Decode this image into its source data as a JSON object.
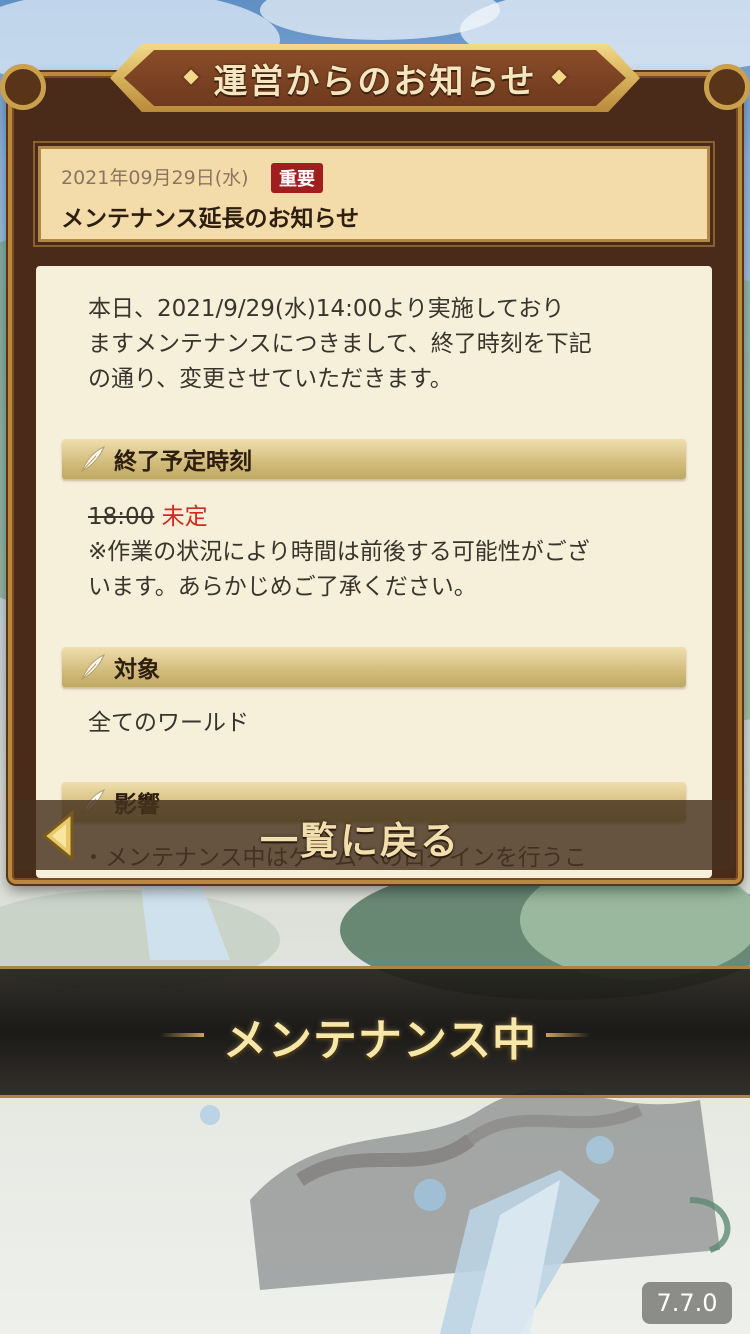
{
  "window_title": "運営からのお知らせ",
  "notice": {
    "date": "2021年09月29日(水)",
    "badge": "重要",
    "title": "メンテナンス延長のお知らせ",
    "intro_lines": [
      "本日、2021/9/29(水)14:00より実施しており",
      "ますメンテナンスにつきまして、終了時刻を下記",
      "の通り、変更させていただきます。"
    ],
    "sections": [
      {
        "heading": "終了予定時刻",
        "old_time": "18:00",
        "new_time": "未定",
        "note_lines": [
          "※作業の状況により時間は前後する可能性がござ",
          "います。あらかじめご了承ください。"
        ]
      },
      {
        "heading": "対象",
        "body": "全てのワールド"
      },
      {
        "heading": "影響",
        "body": "・メンテナンス中はゲームへのログインを行うこ"
      }
    ]
  },
  "back_button": {
    "label": "一覧に戻る",
    "icon": "back-arrow-icon"
  },
  "status_banner": {
    "text": "メンテナンス中"
  },
  "version": "7.7.0",
  "colors": {
    "panel_frame": "#4a2a18",
    "gold": "#c9a556",
    "content_bg": "#f6efda",
    "badge_red": "#a01e1e",
    "accent_red": "#d2291e"
  }
}
